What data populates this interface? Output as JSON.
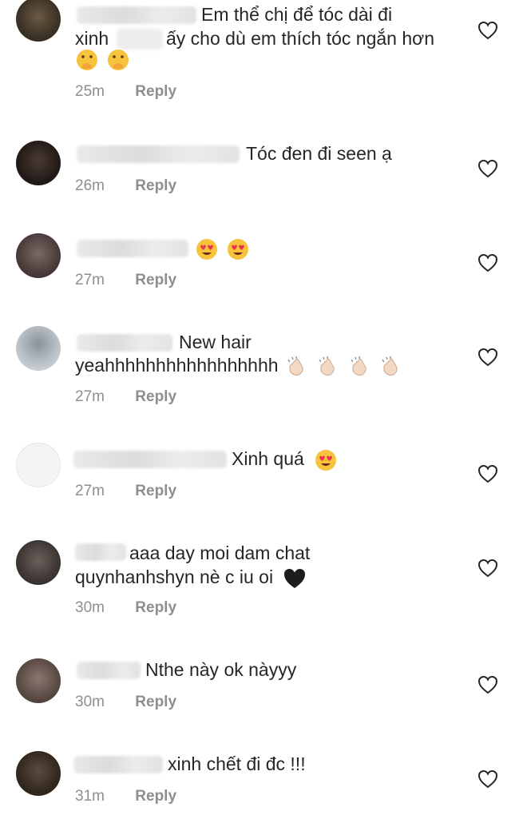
{
  "comments": [
    {
      "line1": "Em thể chị để tóc dài đi",
      "line2a": "xinh",
      "line2b": "ấy cho dù em thích tóc ngắn hơn",
      "time": "25m",
      "reply": "Reply"
    },
    {
      "text": "Tóc đen đi seen ạ",
      "time": "26m",
      "reply": "Reply"
    },
    {
      "time": "27m",
      "reply": "Reply"
    },
    {
      "line1": "New hair",
      "line2": "yeahhhhhhhhhhhhhhhhh",
      "time": "27m",
      "reply": "Reply"
    },
    {
      "text": "Xinh quá",
      "time": "27m",
      "reply": "Reply"
    },
    {
      "line1": "aaa day moi dam chat",
      "line2": "quynhanhshyn nè c iu oi",
      "time": "30m",
      "reply": "Reply"
    },
    {
      "text": "Nthe này ok nàyyy",
      "time": "30m",
      "reply": "Reply"
    },
    {
      "text": "xinh chết đi đc !!!",
      "time": "31m",
      "reply": "Reply"
    }
  ],
  "icons": {
    "heart": "heart-outline-icon",
    "face_hand": "face-with-hand-over-mouth-emoji",
    "heart_eyes": "heart-eyes-emoji",
    "clap": "clapping-hands-emoji",
    "black_heart": "black-heart-emoji"
  },
  "colors": {
    "text": "#262626",
    "meta": "#8e8e8e",
    "background": "#ffffff"
  }
}
